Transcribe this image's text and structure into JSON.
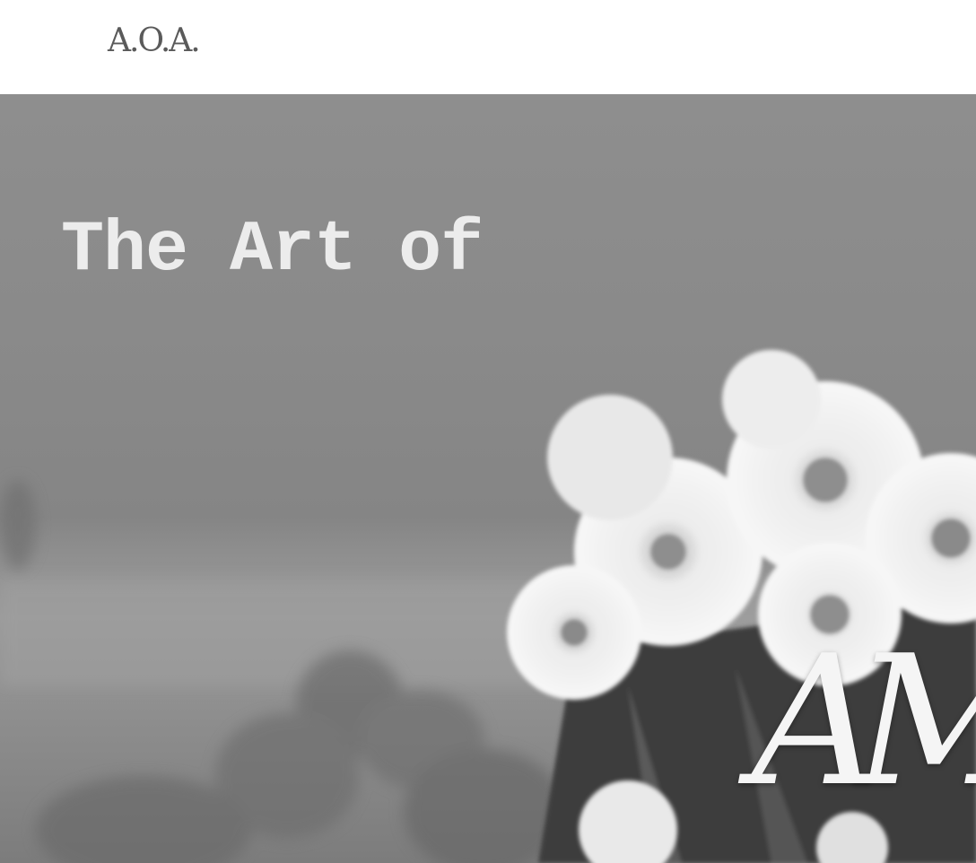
{
  "header": {
    "logo_text": "A.O.A."
  },
  "hero": {
    "heading": "The Art of",
    "monogram": "AM",
    "image_description": "flowers-photo"
  },
  "colors": {
    "header_background": "#ffffff",
    "logo_text": "#5a5a5a",
    "hero_text": "#ececec"
  }
}
